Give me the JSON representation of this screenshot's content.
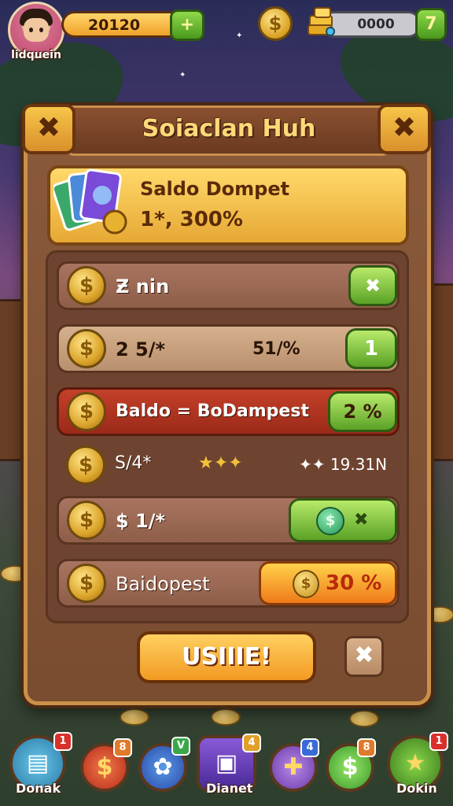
{
  "top_bar": {
    "player_name": "lidquein",
    "xp_value": "20120",
    "xp_add_label": "+",
    "coin_icon": "coin-icon",
    "gem_value": "0000",
    "gem_add_label": "7"
  },
  "dialog": {
    "title": "Soiaclan Huh",
    "close_left_label": "✖",
    "close_right_label": "✖",
    "wallet": {
      "title": "Saldo Dompet",
      "value": "1*, 300%"
    },
    "rows": [
      {
        "label": "Ƶ nin",
        "middle": "",
        "button": "✖",
        "style": "brown"
      },
      {
        "label": "2 5/*",
        "middle": "51/%",
        "button": "1",
        "style": "tan"
      },
      {
        "label": "Baldo = BoDampest",
        "middle": "",
        "button": "2 %",
        "style": "red"
      },
      {
        "label": "S/4*",
        "middle": "★✦✦",
        "button": "✦✦ 19.31N",
        "style": "plain"
      },
      {
        "label": "$ 1/*",
        "middle": "",
        "button": "✖",
        "style": "brown"
      },
      {
        "label": "Baidopest",
        "middle": "",
        "button": "30 %",
        "style": "brown"
      }
    ],
    "use_button": "USIIIE!",
    "close_button": "✖"
  },
  "bottom_nav": [
    {
      "label": "Donak",
      "badge": "1",
      "icon": "cash-stack-icon"
    },
    {
      "label": "",
      "badge": "8",
      "icon": "dollar-coin-icon"
    },
    {
      "label": "",
      "badge": "V",
      "icon": "plant-pot-icon"
    },
    {
      "label": "Dianet",
      "badge": "4",
      "icon": "chest-icon"
    },
    {
      "label": "",
      "badge": "4",
      "icon": "plus-icon"
    },
    {
      "label": "",
      "badge": "8",
      "icon": "green-coin-icon"
    },
    {
      "label": "Dokin",
      "badge": "1",
      "icon": "star-icon"
    }
  ],
  "colors": {
    "panel": "#8a5a3a",
    "accent_gold": "#ffd96a",
    "button_green": "#5aa226",
    "button_orange": "#f07a1a",
    "row_red": "#c4402a"
  }
}
